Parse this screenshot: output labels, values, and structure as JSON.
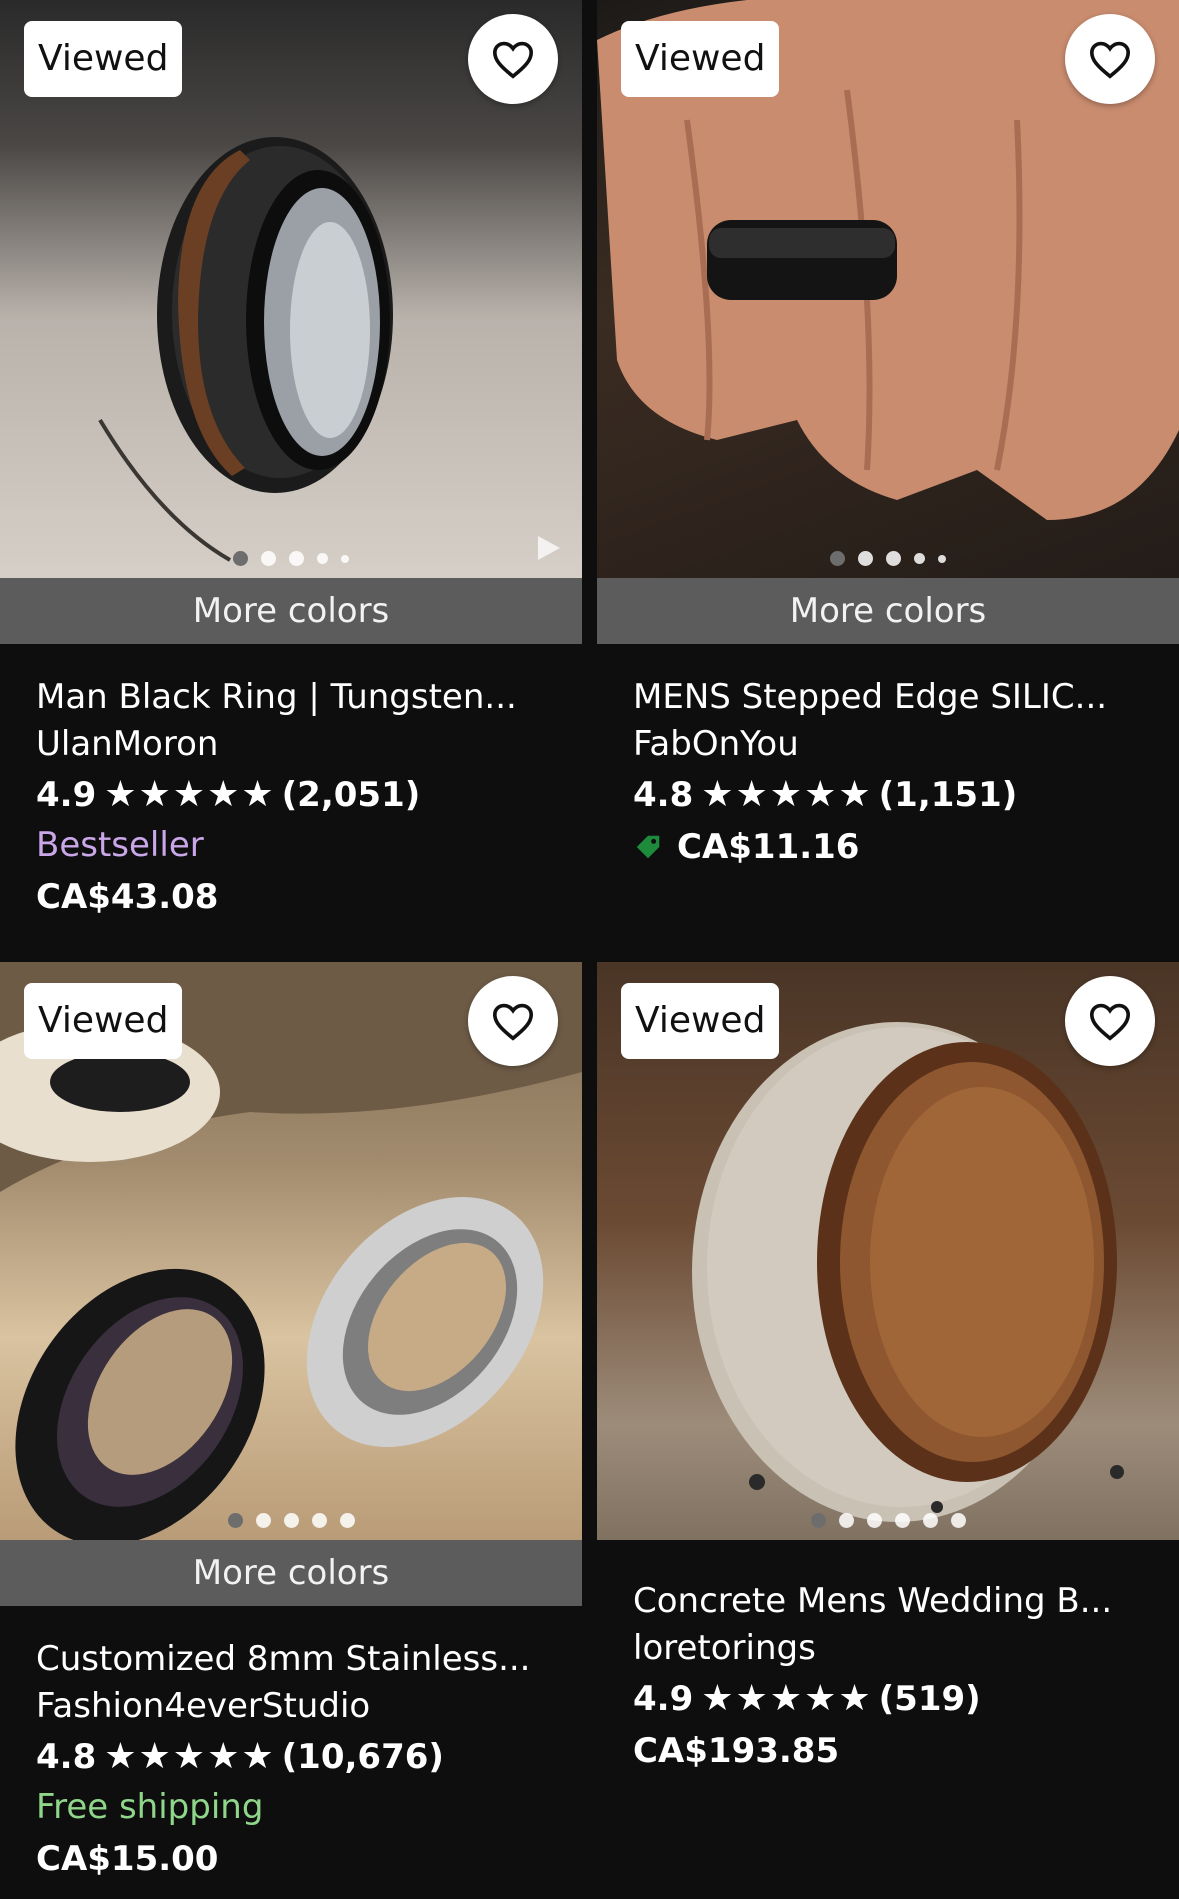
{
  "labels": {
    "viewed": "Viewed",
    "more_colors": "More colors"
  },
  "products": [
    {
      "title": "Man Black Ring | Tungsten...",
      "shop": "UlanMoron",
      "rating": "4.9",
      "reviews": "(2,051)",
      "badge": "Bestseller",
      "price": "CA$43.08",
      "image_icon": "black-wood-ring-photo",
      "carousel_dots": 5,
      "active_dot": 0
    },
    {
      "title": "MENS Stepped Edge SILIC...",
      "shop": "FabOnYou",
      "rating": "4.8",
      "reviews": "(1,151)",
      "price": "CA$11.16",
      "sale_icon": "tag-icon",
      "image_icon": "hand-silicone-ring-photo",
      "carousel_dots": 5,
      "active_dot": 0
    },
    {
      "title": "Customized 8mm Stainless...",
      "shop": "Fashion4everStudio",
      "rating": "4.8",
      "reviews": "(10,676)",
      "badge": "Free shipping",
      "price": "CA$15.00",
      "image_icon": "steel-rings-photo",
      "carousel_dots": 5,
      "active_dot": 0
    },
    {
      "title": "Concrete Mens Wedding B...",
      "shop": "loretorings",
      "rating": "4.9",
      "reviews": "(519)",
      "price": "CA$193.85",
      "image_icon": "concrete-wood-ring-photo",
      "carousel_dots": 6,
      "active_dot": 0
    }
  ],
  "colors": {
    "bestseller": "#c9a7e8",
    "free_shipping": "#8fd68a",
    "sale_tag": "#1e8a3c",
    "more_colors_bar": "#5c5c5c"
  }
}
